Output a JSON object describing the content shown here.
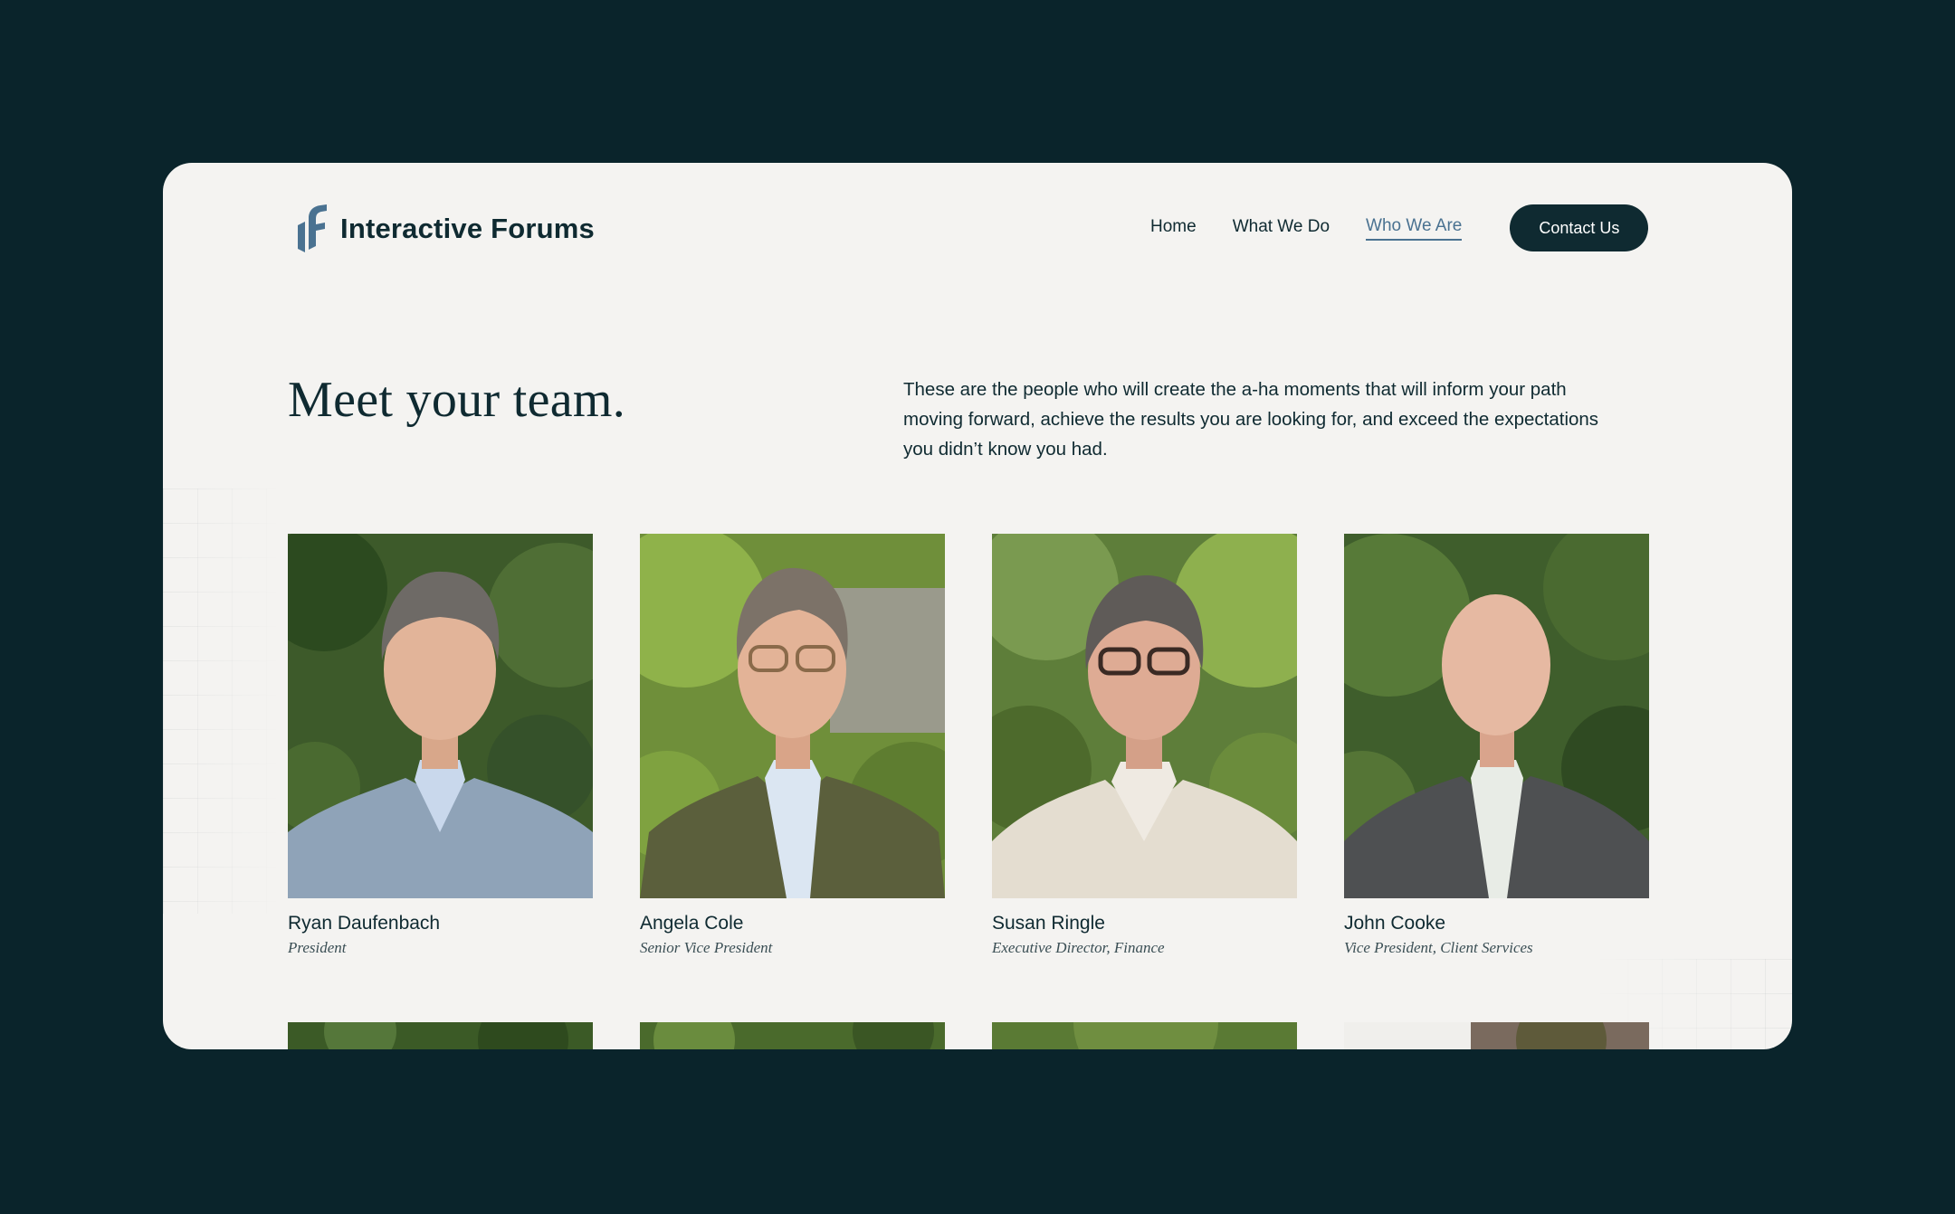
{
  "brand": {
    "name": "Interactive Forums",
    "logo_icon": "interactive-forums-logo-icon",
    "colors": {
      "background": "#0a242b",
      "card": "#f4f3f1",
      "ink": "#0f2a31",
      "accent": "#4a7291"
    }
  },
  "nav": {
    "items": [
      {
        "label": "Home",
        "active": false
      },
      {
        "label": "What We Do",
        "active": false
      },
      {
        "label": "Who We Are",
        "active": true
      }
    ],
    "cta": "Contact Us"
  },
  "intro": {
    "title": "Meet your team.",
    "text": "These are the people who will create the a-ha moments that will inform your path moving forward, achieve the results you are looking for, and exceed the expectations you didn’t know you had."
  },
  "team": [
    {
      "name": "Ryan Daufenbach",
      "title": "President"
    },
    {
      "name": "Angela Cole",
      "title": "Senior Vice President"
    },
    {
      "name": "Susan Ringle",
      "title": "Executive Director, Finance"
    },
    {
      "name": "John Cooke",
      "title": "Vice President, Client Services"
    }
  ]
}
